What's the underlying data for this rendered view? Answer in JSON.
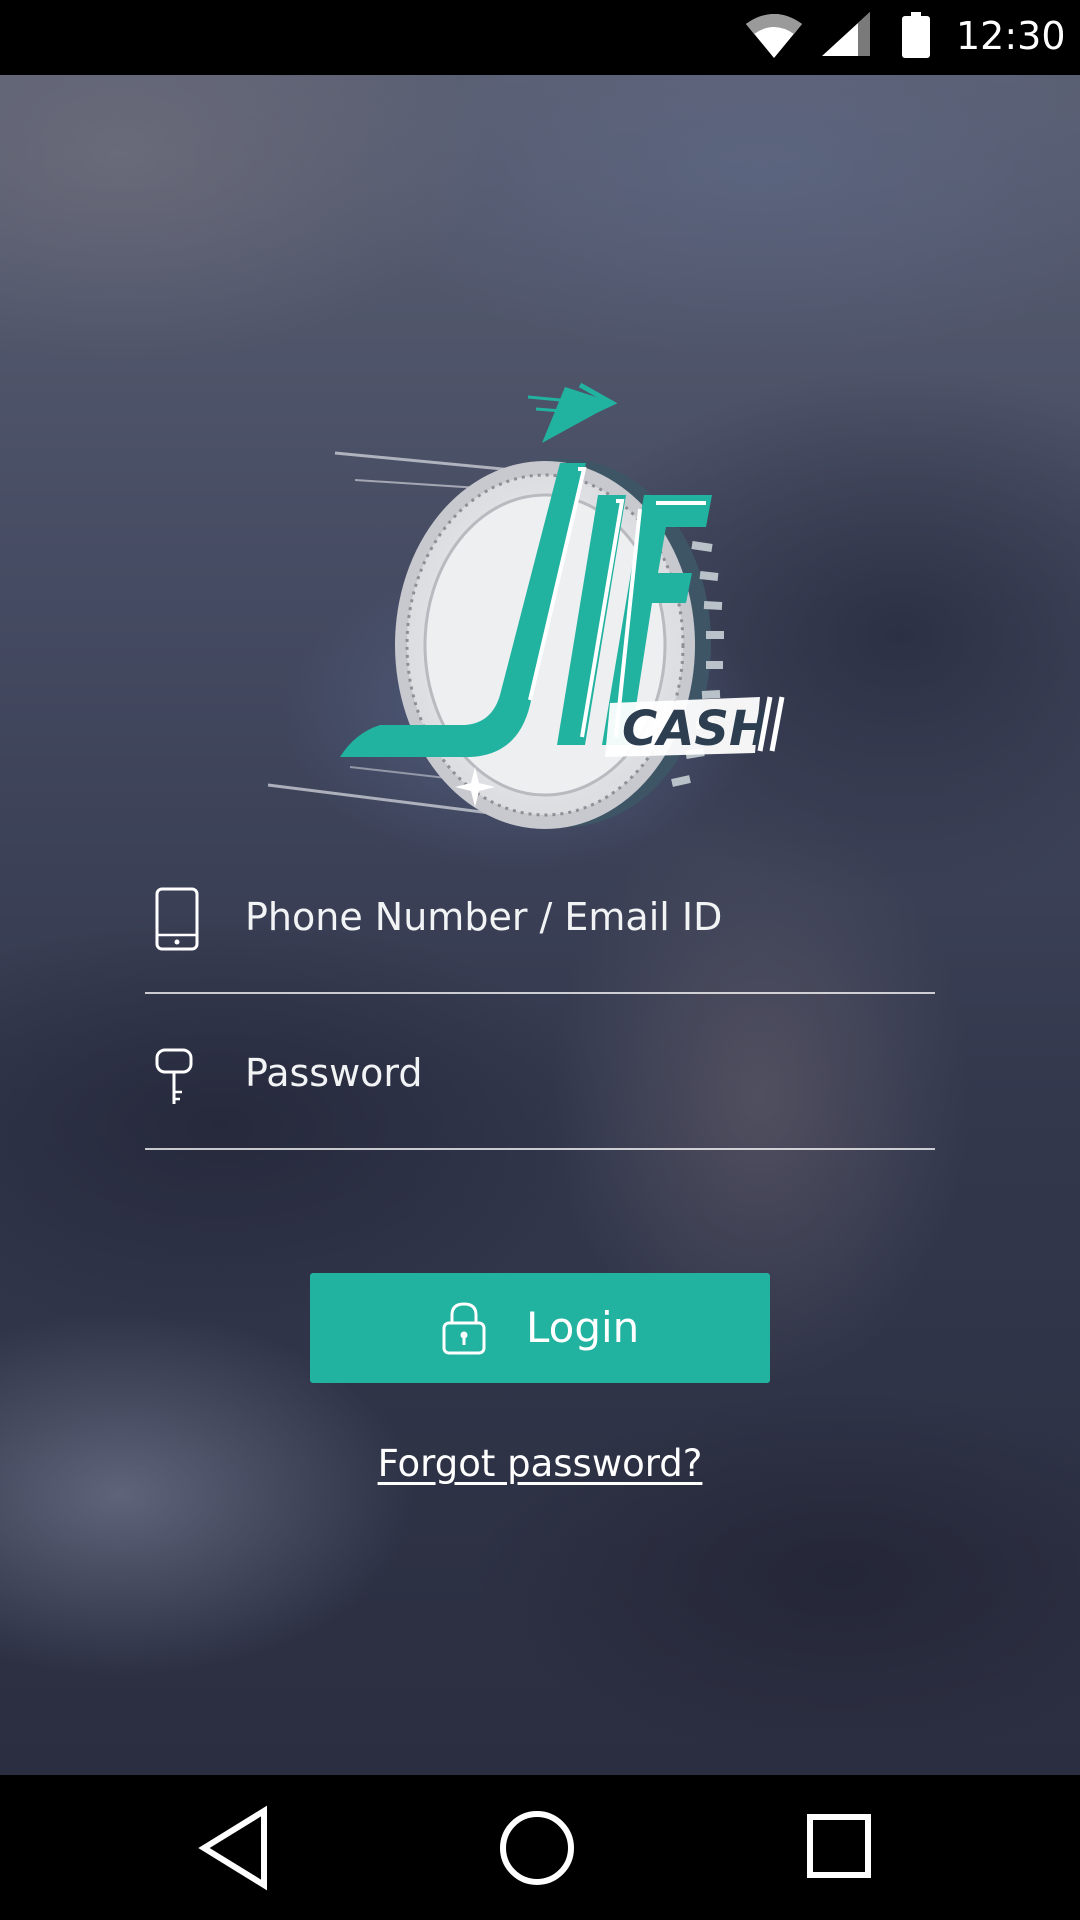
{
  "status_bar": {
    "time": "12:30",
    "icons": [
      "wifi-icon",
      "cell-signal-icon",
      "battery-icon"
    ]
  },
  "logo": {
    "text_main": "JIF",
    "text_sub": "CASH",
    "colors": {
      "teal": "#21b2a0",
      "navy": "#2c3e50",
      "coin": "#e8e9eb"
    }
  },
  "form": {
    "phone_placeholder": "Phone Number / Email ID",
    "phone_icon": "phone-icon",
    "password_placeholder": "Password",
    "password_icon": "key-icon"
  },
  "login_button": {
    "label": "Login",
    "icon": "lock-icon",
    "color": "#21b2a0"
  },
  "forgot_password_label": "Forgot password?",
  "nav_bar": {
    "icons": [
      "back-icon",
      "home-icon",
      "recents-icon"
    ]
  }
}
